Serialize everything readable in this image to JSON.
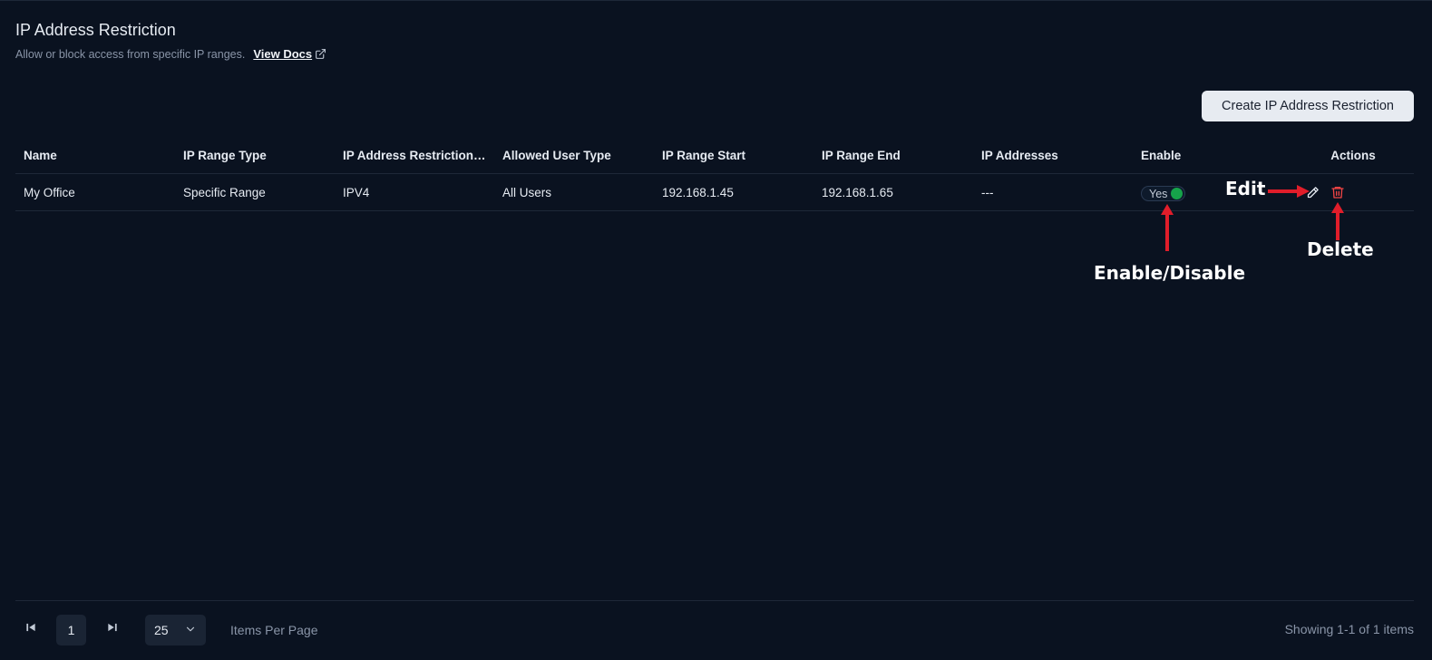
{
  "header": {
    "title": "IP Address Restriction",
    "subtitle": "Allow or block access from specific IP ranges.",
    "docs_link": "View Docs"
  },
  "toolbar": {
    "create_label": "Create IP Address Restriction"
  },
  "table": {
    "columns": [
      "Name",
      "IP Range Type",
      "IP Address Restriction ...",
      "Allowed User Type",
      "IP Range Start",
      "IP Range End",
      "IP Addresses",
      "Enable",
      "Actions"
    ],
    "rows": [
      {
        "name": "My Office",
        "range_type": "Specific Range",
        "restriction": "IPV4",
        "user_type": "All Users",
        "range_start": "192.168.1.45",
        "range_end": "192.168.1.65",
        "ip_addresses": "---",
        "enable_label": "Yes"
      }
    ]
  },
  "annotations": {
    "edit": "Edit",
    "delete": "Delete",
    "enable_disable": "Enable/Disable"
  },
  "pagination": {
    "page": "1",
    "page_size": "25",
    "items_per_page_label": "Items Per Page",
    "showing": "Showing 1-1 of 1 items"
  },
  "colors": {
    "background": "#0a1220",
    "accent_toggle": "#16a34a",
    "delete": "#ef4444",
    "annotation_arrow": "#e11d2a"
  },
  "icons": {
    "external_link": "external-link-icon",
    "edit": "pencil-icon",
    "delete": "trash-icon",
    "first_page": "first-page-icon",
    "last_page": "last-page-icon",
    "dropdown": "chevron-down-icon"
  }
}
